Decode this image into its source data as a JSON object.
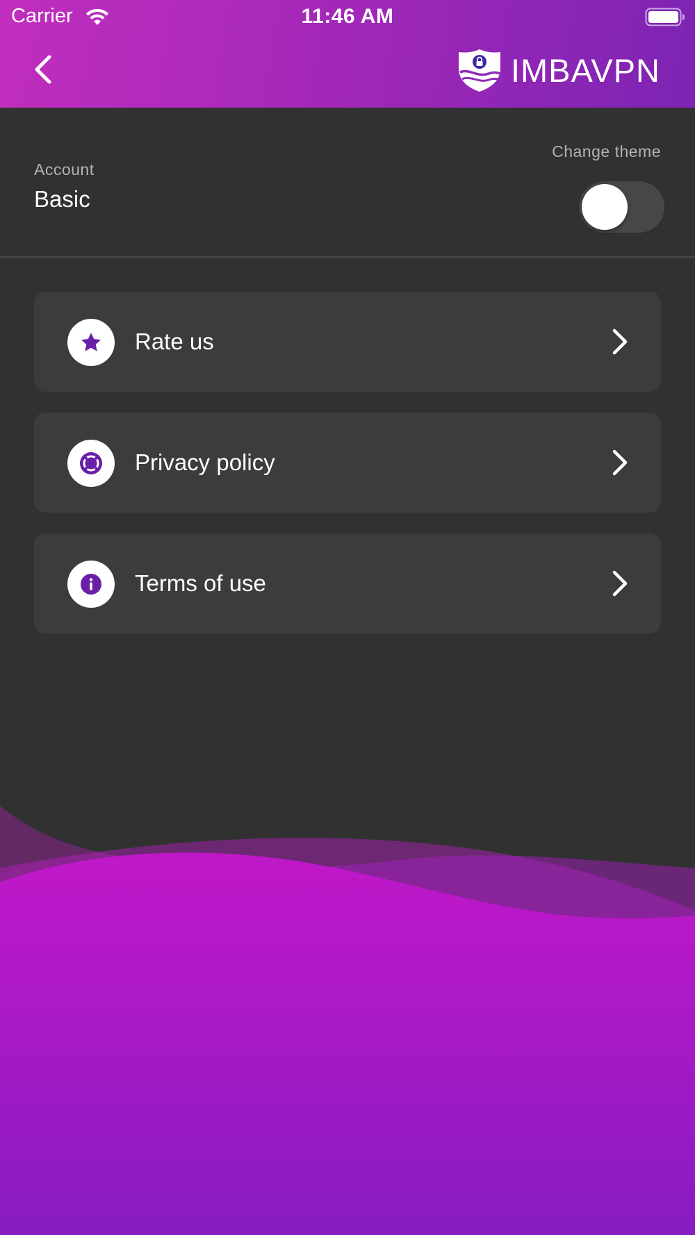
{
  "status_bar": {
    "carrier": "Carrier",
    "time": "11:46 AM",
    "icons": [
      "wifi-icon",
      "battery-icon"
    ]
  },
  "header": {
    "back_icon": "chevron-left-icon",
    "logo_icon": "shield-lock-icon",
    "brand_name": "IMBAVPN"
  },
  "account": {
    "label": "Account",
    "value": "Basic"
  },
  "theme": {
    "label": "Change theme",
    "toggle_on": false
  },
  "menu": {
    "items": [
      {
        "label": "Rate us",
        "icon": "star-icon"
      },
      {
        "label": "Privacy policy",
        "icon": "lifebuoy-icon"
      },
      {
        "label": "Terms of use",
        "icon": "info-icon"
      }
    ],
    "chevron_icon": "chevron-right-icon"
  },
  "colors": {
    "accent": "#6a1fa8",
    "header_gradient_start": "#c12ebd",
    "header_gradient_end": "#7c24b3",
    "background": "#313131",
    "card": "#3c3c3c",
    "wave_magenta": "#b919c8",
    "wave_purple": "#8a1cc0"
  }
}
